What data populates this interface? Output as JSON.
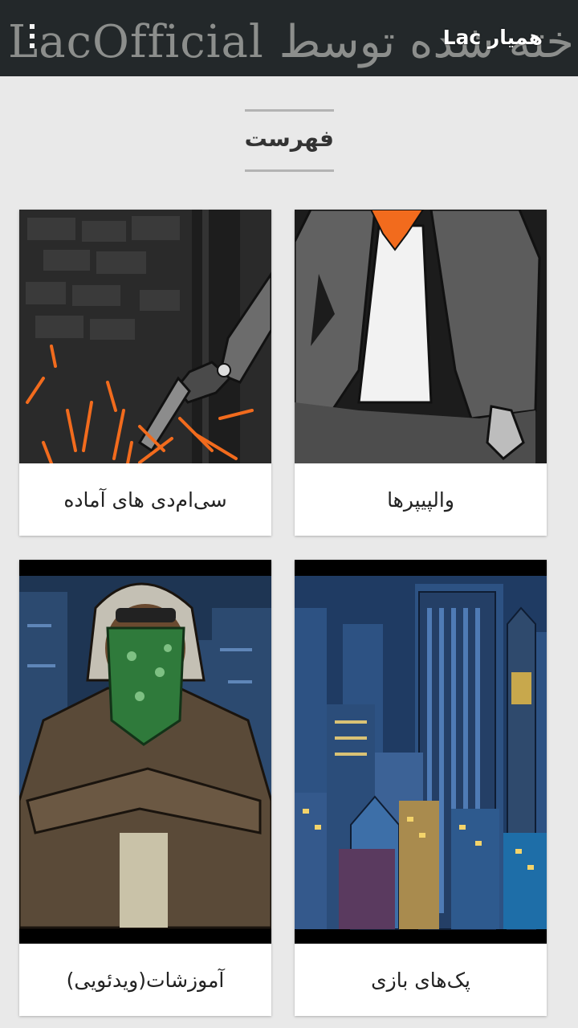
{
  "app_bar": {
    "watermark_text": "LacOfficial ساخته شده توسط",
    "title": "همیار Lac",
    "menu_icon": "overflow-menu-icon",
    "background": "#23282a"
  },
  "menu_section": {
    "title": "فهرست"
  },
  "cards": {
    "ready_cmds": {
      "label": "سی‌ام‌دی های آماده",
      "image": "gunfire-sparks-illustration"
    },
    "wallpapers": {
      "label": "والپیپرها",
      "image": "jacket-character-illustration"
    },
    "tutorials": {
      "label": "آموزشات(ویدئویی)",
      "image": "masked-character-illustration"
    },
    "game_packs": {
      "label": "پک‌های بازی",
      "image": "city-skyline-illustration"
    }
  },
  "colors": {
    "background": "#e9e9e9",
    "card": "#ffffff",
    "accent_orange": "#f26b1d"
  }
}
